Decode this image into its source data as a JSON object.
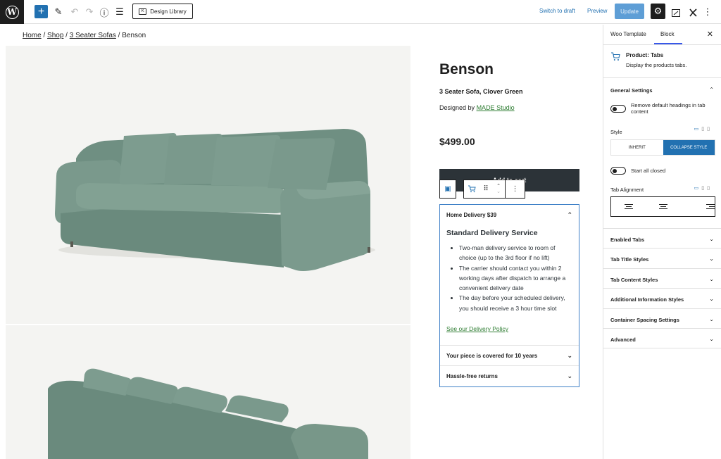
{
  "toolbar": {
    "wp_logo": "W",
    "add_icon": "+",
    "edit_icon": "✎",
    "undo_icon": "↶",
    "redo_icon": "↷",
    "info_icon": "ⓘ",
    "list_view_icon": "☰",
    "design_library_label": "Design Library",
    "switch_to_draft_label": "Switch to draft",
    "preview_label": "Preview",
    "update_label": "Update",
    "settings_icon": "⚙",
    "more_icon": "⋮"
  },
  "breadcrumb": {
    "items": [
      "Home",
      "Shop",
      "3 Seater Sofas"
    ],
    "current": "Benson",
    "separator": "/"
  },
  "product": {
    "title": "Benson",
    "subtitle": "3 Seater Sofa, Clover Green",
    "designed_by_prefix": "Designed by",
    "designer": "MADE Studio",
    "price": "$499.00",
    "add_to_cart_label": "Add to cart"
  },
  "block_toolbar": {
    "parent_icon": "▣",
    "block_icon": "🛒",
    "drag_icon": "⠿",
    "move_up": "⌃",
    "move_down": "⌄",
    "options_icon": "⋮"
  },
  "tabs": {
    "items": [
      {
        "title": "Home Delivery $39",
        "open": true,
        "heading": "Standard Delivery Service",
        "bullets": [
          "Two-man delivery service to room of choice (up to the 3rd floor if no lift)",
          "The carrier should contact you within 2 working days after dispatch to arrange a convenient delivery date",
          "The day before your scheduled delivery, you should receive a 3 hour time slot"
        ],
        "link": "See our Delivery Policy"
      },
      {
        "title": "Your piece is covered for 10 years",
        "open": false
      },
      {
        "title": "Hassle-free returns",
        "open": false
      }
    ],
    "chevron_up": "⌃",
    "chevron_down": "⌄"
  },
  "sidebar": {
    "tabs": [
      "Woo Template",
      "Block"
    ],
    "active_tab": "Block",
    "close_icon": "✕",
    "block": {
      "title": "Product: Tabs",
      "description": "Display the products tabs."
    },
    "general_settings": {
      "title": "General Settings",
      "remove_headings_label": "Remove default headings in tab content",
      "remove_headings_on": false,
      "style_label": "Style",
      "style_options": [
        "INHERIT",
        "COLLAPSE STYLE"
      ],
      "style_selected": "COLLAPSE STYLE",
      "start_closed_label": "Start all closed",
      "start_closed_on": false,
      "alignment_label": "Tab Alignment"
    },
    "sections": [
      "Enabled Tabs",
      "Tab Title Styles",
      "Tab Content Styles",
      "Additional Information Styles",
      "Container Spacing Settings",
      "Advanced"
    ],
    "accent_color": "#2271b1"
  }
}
